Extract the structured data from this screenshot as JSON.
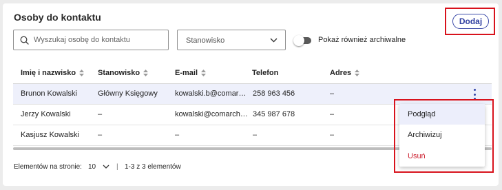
{
  "panel": {
    "title": "Osoby do kontaktu",
    "add_label": "Dodaj"
  },
  "filters": {
    "search_placeholder": "Wyszukaj osobę do kontaktu",
    "position_select": "Stanowisko",
    "archived_toggle_label": "Pokaż również archiwalne",
    "archived_toggle_on": false
  },
  "table": {
    "columns": [
      "Imię i nazwisko",
      "Stanowisko",
      "E-mail",
      "Telefon",
      "Adres"
    ],
    "rows": [
      [
        "Brunon Kowalski",
        "Główny Księgowy",
        "kowalski.b@comar…",
        "258 963 456",
        "–"
      ],
      [
        "Jerzy Kowalski",
        "–",
        "kowalski@comarch…",
        "345 987 678",
        "–"
      ],
      [
        "Kasjusz Kowalski",
        "–",
        "–",
        "–",
        "–"
      ]
    ]
  },
  "pagination": {
    "per_page_label": "Elementów na stronie:",
    "per_page_value": "10",
    "range": "1-3 z 3 elementów"
  },
  "context_menu": {
    "items": [
      "Podgląd",
      "Archiwizuj",
      "Usuń"
    ]
  },
  "colors": {
    "accent": "#2f3ea0",
    "danger": "#cc1f2f",
    "highlight_outline": "#d8121c"
  }
}
